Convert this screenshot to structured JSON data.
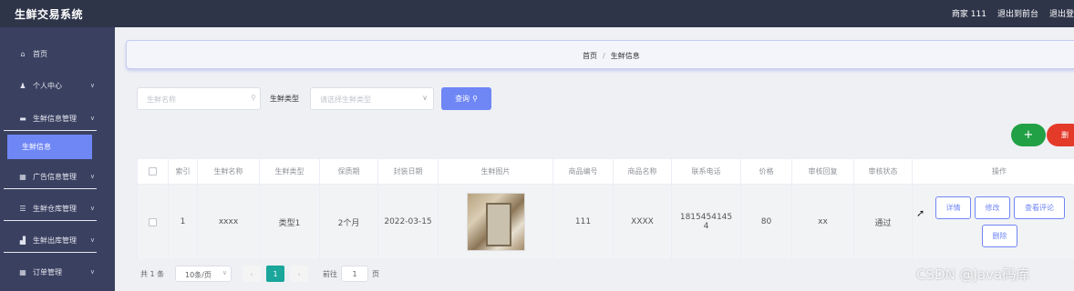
{
  "header": {
    "app_title": "生鲜交易系统",
    "user_label": "商家 111",
    "back_to_front": "退出到前台",
    "logout": "退出登"
  },
  "sidebar": {
    "items": [
      {
        "label": "首页",
        "icon": "home-icon"
      },
      {
        "label": "个人中心",
        "icon": "user-icon"
      },
      {
        "label": "生鲜信息管理",
        "icon": "list-icon"
      },
      {
        "label": "生鲜信息",
        "icon": ""
      },
      {
        "label": "广告信息管理",
        "icon": "grid-icon"
      },
      {
        "label": "生鲜仓库管理",
        "icon": "menu-icon"
      },
      {
        "label": "生鲜出库管理",
        "icon": "shop-icon"
      },
      {
        "label": "订单管理",
        "icon": "grid-icon"
      }
    ],
    "active": "生鲜信息"
  },
  "breadcrumb": {
    "home": "首页",
    "separator": "/",
    "current": "生鲜信息"
  },
  "search": {
    "name_placeholder": "生鲜名称",
    "type_label": "生鲜类型",
    "type_placeholder": "请选择生鲜类型",
    "query_label": "查询"
  },
  "actions": {
    "add": "+",
    "delete": "删"
  },
  "table": {
    "columns": [
      "索引",
      "生鲜名称",
      "生鲜类型",
      "保质期",
      "封装日期",
      "生鲜图片",
      "商品编号",
      "商品名称",
      "联系电话",
      "价格",
      "审核回复",
      "审核状态",
      "操作"
    ],
    "rows": [
      {
        "index": "1",
        "name": "xxxx",
        "type": "类型1",
        "shelf_life": "2个月",
        "pack_date": "2022-03-15",
        "goods_no": "111",
        "goods_name": "XXXX",
        "phone_line1": "1815454145",
        "phone_line2": "4",
        "price": "80",
        "reply": "xx",
        "status": "通过"
      }
    ],
    "row_buttons": {
      "detail": "详情",
      "edit": "修改",
      "view_comments": "查看评论",
      "delete": "删除"
    }
  },
  "pagination": {
    "total": "共 1 条",
    "page_size": "10条/页",
    "current_page": "1",
    "goto_label": "前往",
    "goto_value": "1",
    "goto_suffix": "页"
  },
  "watermark": "CSDN @Java码库",
  "colors": {
    "topbar": "#2f3549",
    "sidebar": "#3a4060",
    "accent": "#6f86f5",
    "add": "#22a045",
    "delete": "#e33a2a",
    "page_active": "#1aa69b"
  }
}
